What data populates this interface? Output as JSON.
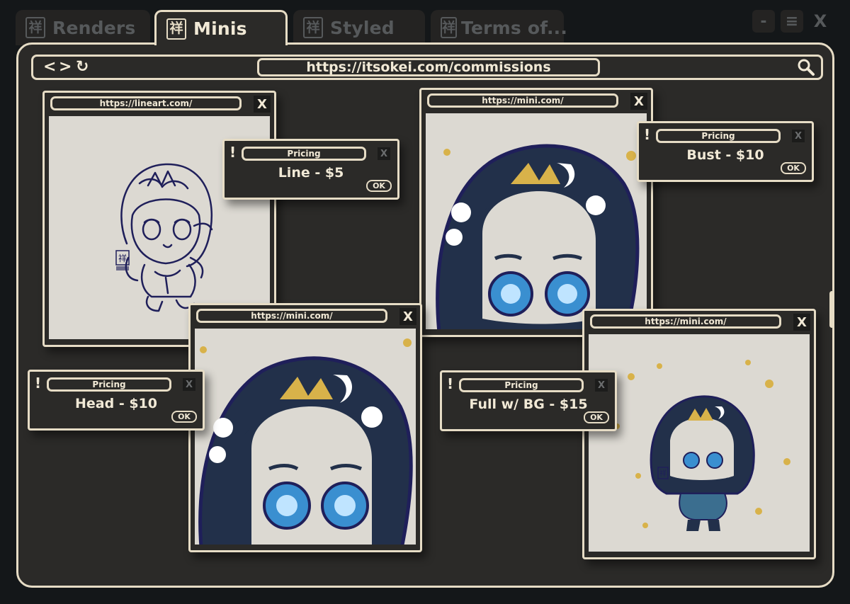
{
  "tabs": [
    {
      "label": "Renders",
      "active": false
    },
    {
      "label": "Minis",
      "active": true
    },
    {
      "label": "Styled",
      "active": false
    },
    {
      "label": "Terms of...",
      "active": false
    }
  ],
  "window_controls": {
    "minimize": "-",
    "menu": "≡",
    "close": "X"
  },
  "browser": {
    "url": "https://itsokei.com/commissions",
    "nav": {
      "back": "<",
      "forward": ">",
      "reload": "↻"
    }
  },
  "windows": [
    {
      "url": "https://lineart.com/",
      "close": "X"
    },
    {
      "url": "https://mini.com/",
      "close": "X"
    },
    {
      "url": "https://mini.com/",
      "close": "X"
    },
    {
      "url": "https://mini.com/",
      "close": "X"
    }
  ],
  "popups": [
    {
      "title": "Pricing",
      "price": "Line - $5",
      "ok": "OK",
      "x": "X",
      "alert": "!"
    },
    {
      "title": "Pricing",
      "price": "Bust - $10",
      "ok": "OK",
      "x": "X",
      "alert": "!"
    },
    {
      "title": "Pricing",
      "price": "Head - $10",
      "ok": "OK",
      "x": "X",
      "alert": "!"
    },
    {
      "title": "Pricing",
      "price": "Full w/ BG - $15",
      "ok": "OK",
      "x": "X",
      "alert": "!"
    }
  ],
  "tab_icon": "祥",
  "colors": {
    "frame": "#2b2a28",
    "border": "#e6dcc5",
    "text": "#f1e9d6",
    "background": "#141719",
    "canvas": "#dcd9d2",
    "ink": "#1f1f5a",
    "hair": "#22304a",
    "gold": "#d8b24a",
    "eye": "#3a8fd0"
  }
}
